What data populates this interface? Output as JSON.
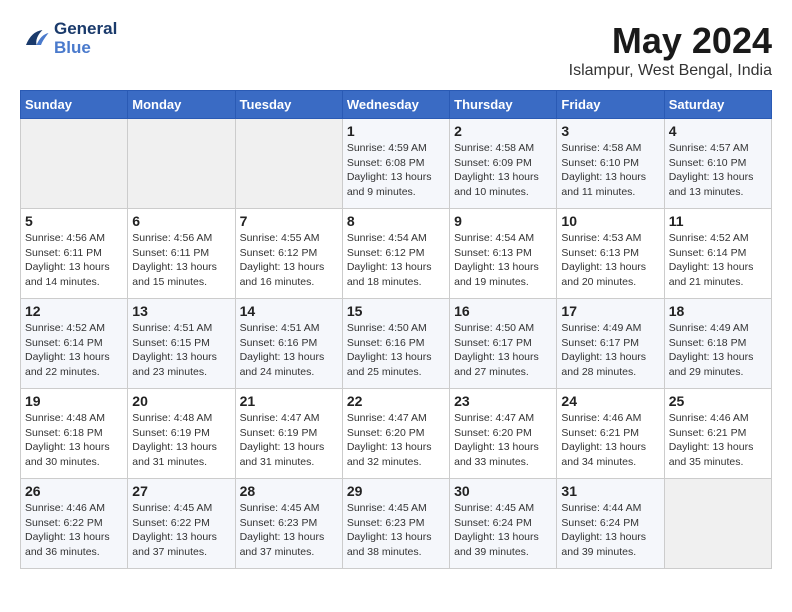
{
  "header": {
    "logo_line1": "General",
    "logo_line2": "Blue",
    "month": "May 2024",
    "location": "Islampur, West Bengal, India"
  },
  "weekdays": [
    "Sunday",
    "Monday",
    "Tuesday",
    "Wednesday",
    "Thursday",
    "Friday",
    "Saturday"
  ],
  "weeks": [
    [
      {
        "day": "",
        "info": ""
      },
      {
        "day": "",
        "info": ""
      },
      {
        "day": "",
        "info": ""
      },
      {
        "day": "1",
        "info": "Sunrise: 4:59 AM\nSunset: 6:08 PM\nDaylight: 13 hours\nand 9 minutes."
      },
      {
        "day": "2",
        "info": "Sunrise: 4:58 AM\nSunset: 6:09 PM\nDaylight: 13 hours\nand 10 minutes."
      },
      {
        "day": "3",
        "info": "Sunrise: 4:58 AM\nSunset: 6:10 PM\nDaylight: 13 hours\nand 11 minutes."
      },
      {
        "day": "4",
        "info": "Sunrise: 4:57 AM\nSunset: 6:10 PM\nDaylight: 13 hours\nand 13 minutes."
      }
    ],
    [
      {
        "day": "5",
        "info": "Sunrise: 4:56 AM\nSunset: 6:11 PM\nDaylight: 13 hours\nand 14 minutes."
      },
      {
        "day": "6",
        "info": "Sunrise: 4:56 AM\nSunset: 6:11 PM\nDaylight: 13 hours\nand 15 minutes."
      },
      {
        "day": "7",
        "info": "Sunrise: 4:55 AM\nSunset: 6:12 PM\nDaylight: 13 hours\nand 16 minutes."
      },
      {
        "day": "8",
        "info": "Sunrise: 4:54 AM\nSunset: 6:12 PM\nDaylight: 13 hours\nand 18 minutes."
      },
      {
        "day": "9",
        "info": "Sunrise: 4:54 AM\nSunset: 6:13 PM\nDaylight: 13 hours\nand 19 minutes."
      },
      {
        "day": "10",
        "info": "Sunrise: 4:53 AM\nSunset: 6:13 PM\nDaylight: 13 hours\nand 20 minutes."
      },
      {
        "day": "11",
        "info": "Sunrise: 4:52 AM\nSunset: 6:14 PM\nDaylight: 13 hours\nand 21 minutes."
      }
    ],
    [
      {
        "day": "12",
        "info": "Sunrise: 4:52 AM\nSunset: 6:14 PM\nDaylight: 13 hours\nand 22 minutes."
      },
      {
        "day": "13",
        "info": "Sunrise: 4:51 AM\nSunset: 6:15 PM\nDaylight: 13 hours\nand 23 minutes."
      },
      {
        "day": "14",
        "info": "Sunrise: 4:51 AM\nSunset: 6:16 PM\nDaylight: 13 hours\nand 24 minutes."
      },
      {
        "day": "15",
        "info": "Sunrise: 4:50 AM\nSunset: 6:16 PM\nDaylight: 13 hours\nand 25 minutes."
      },
      {
        "day": "16",
        "info": "Sunrise: 4:50 AM\nSunset: 6:17 PM\nDaylight: 13 hours\nand 27 minutes."
      },
      {
        "day": "17",
        "info": "Sunrise: 4:49 AM\nSunset: 6:17 PM\nDaylight: 13 hours\nand 28 minutes."
      },
      {
        "day": "18",
        "info": "Sunrise: 4:49 AM\nSunset: 6:18 PM\nDaylight: 13 hours\nand 29 minutes."
      }
    ],
    [
      {
        "day": "19",
        "info": "Sunrise: 4:48 AM\nSunset: 6:18 PM\nDaylight: 13 hours\nand 30 minutes."
      },
      {
        "day": "20",
        "info": "Sunrise: 4:48 AM\nSunset: 6:19 PM\nDaylight: 13 hours\nand 31 minutes."
      },
      {
        "day": "21",
        "info": "Sunrise: 4:47 AM\nSunset: 6:19 PM\nDaylight: 13 hours\nand 31 minutes."
      },
      {
        "day": "22",
        "info": "Sunrise: 4:47 AM\nSunset: 6:20 PM\nDaylight: 13 hours\nand 32 minutes."
      },
      {
        "day": "23",
        "info": "Sunrise: 4:47 AM\nSunset: 6:20 PM\nDaylight: 13 hours\nand 33 minutes."
      },
      {
        "day": "24",
        "info": "Sunrise: 4:46 AM\nSunset: 6:21 PM\nDaylight: 13 hours\nand 34 minutes."
      },
      {
        "day": "25",
        "info": "Sunrise: 4:46 AM\nSunset: 6:21 PM\nDaylight: 13 hours\nand 35 minutes."
      }
    ],
    [
      {
        "day": "26",
        "info": "Sunrise: 4:46 AM\nSunset: 6:22 PM\nDaylight: 13 hours\nand 36 minutes."
      },
      {
        "day": "27",
        "info": "Sunrise: 4:45 AM\nSunset: 6:22 PM\nDaylight: 13 hours\nand 37 minutes."
      },
      {
        "day": "28",
        "info": "Sunrise: 4:45 AM\nSunset: 6:23 PM\nDaylight: 13 hours\nand 37 minutes."
      },
      {
        "day": "29",
        "info": "Sunrise: 4:45 AM\nSunset: 6:23 PM\nDaylight: 13 hours\nand 38 minutes."
      },
      {
        "day": "30",
        "info": "Sunrise: 4:45 AM\nSunset: 6:24 PM\nDaylight: 13 hours\nand 39 minutes."
      },
      {
        "day": "31",
        "info": "Sunrise: 4:44 AM\nSunset: 6:24 PM\nDaylight: 13 hours\nand 39 minutes."
      },
      {
        "day": "",
        "info": ""
      }
    ]
  ]
}
